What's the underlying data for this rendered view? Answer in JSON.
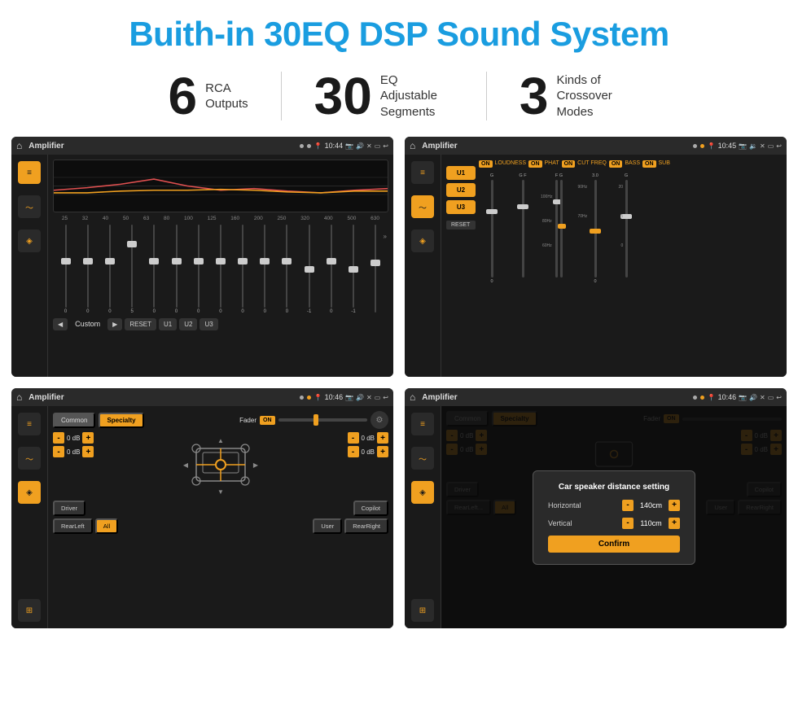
{
  "title": "Buith-in 30EQ DSP Sound System",
  "stats": [
    {
      "number": "6",
      "label": "RCA\nOutputs"
    },
    {
      "number": "30",
      "label": "EQ Adjustable\nSegments"
    },
    {
      "number": "3",
      "label": "Kinds of\nCrossover Modes"
    }
  ],
  "screens": [
    {
      "id": "eq-screen",
      "status_bar": {
        "title": "Amplifier",
        "time": "10:44"
      },
      "type": "eq"
    },
    {
      "id": "crossover-screen",
      "status_bar": {
        "title": "Amplifier",
        "time": "10:45"
      },
      "type": "crossover"
    },
    {
      "id": "fader-screen",
      "status_bar": {
        "title": "Amplifier",
        "time": "10:46"
      },
      "type": "fader"
    },
    {
      "id": "dialog-screen",
      "status_bar": {
        "title": "Amplifier",
        "time": "10:46"
      },
      "type": "dialog"
    }
  ],
  "eq": {
    "frequencies": [
      "25",
      "32",
      "40",
      "50",
      "63",
      "80",
      "100",
      "125",
      "160",
      "200",
      "250",
      "320",
      "400",
      "500",
      "630"
    ],
    "values": [
      "0",
      "0",
      "0",
      "5",
      "0",
      "0",
      "0",
      "0",
      "0",
      "0",
      "0",
      "-1",
      "0",
      "-1",
      ""
    ],
    "bottom_buttons": [
      "◀",
      "Custom",
      "▶",
      "RESET",
      "U1",
      "U2",
      "U3"
    ]
  },
  "crossover": {
    "u_buttons": [
      "U1",
      "U2",
      "U3"
    ],
    "on_labels": [
      "ON",
      "ON",
      "ON",
      "ON",
      "ON"
    ],
    "channel_labels": [
      "LOUDNESS",
      "PHAT",
      "CUT FREQ",
      "BASS",
      "SUB"
    ],
    "reset_label": "RESET"
  },
  "fader": {
    "tabs": [
      "Common",
      "Specialty"
    ],
    "fader_label": "Fader",
    "on_label": "ON",
    "bottom_buttons": [
      "Driver",
      "RearLeft",
      "All",
      "User",
      "RearRight",
      "Copilot"
    ],
    "db_values": [
      "0 dB",
      "0 dB",
      "0 dB",
      "0 dB"
    ]
  },
  "dialog": {
    "title": "Car speaker distance setting",
    "horizontal_label": "Horizontal",
    "horizontal_value": "140cm",
    "vertical_label": "Vertical",
    "vertical_value": "110cm",
    "confirm_label": "Confirm",
    "tabs": [
      "Common",
      "Specialty"
    ],
    "bottom_buttons": [
      "Driver",
      "RearLeft...",
      "All",
      "User",
      "RearRight",
      "Copilot"
    ]
  },
  "colors": {
    "accent": "#f0a020",
    "blue_title": "#1a9de0",
    "dark_bg": "#1a1a1a",
    "medium_bg": "#2a2a2a"
  }
}
